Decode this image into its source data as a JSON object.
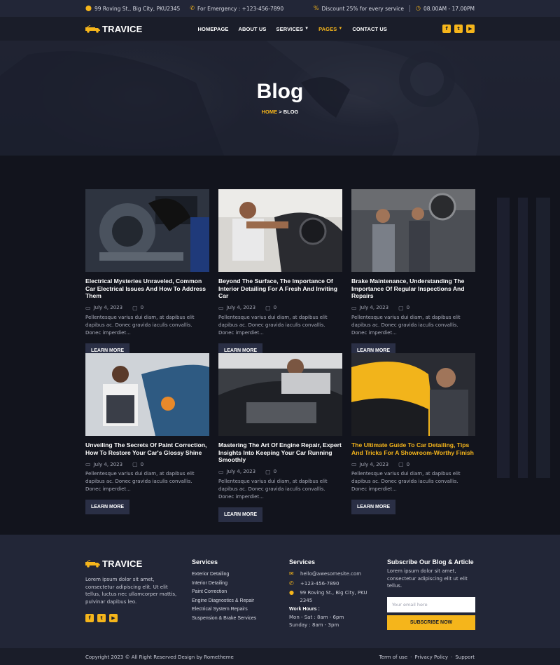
{
  "topbar": {
    "address": "99 Roving St., Big City, PKU2345",
    "emergency": "For Emergency : +123-456-7890",
    "discount": "Discount 25% for every service",
    "hours": "08.00AM - 17.00PM"
  },
  "nav": {
    "logo": "TRAVICE",
    "items": [
      "HOMEPAGE",
      "ABOUT US",
      "SERVICES",
      "PAGES",
      "CONTACT US"
    ],
    "socials": [
      "f",
      "t",
      "▶"
    ]
  },
  "hero": {
    "title": "Blog",
    "home": "HOME",
    "sep": ">",
    "current": "BLOG"
  },
  "posts": [
    {
      "title": "Electrical Mysteries Unraveled, Common Car Electrical Issues And How To Address Them",
      "date": "July 4, 2023",
      "comments": "0",
      "excerpt": "Pellentesque varius dui diam, at dapibus elit dapibus ac. Donec gravida iaculis convallis. Donec imperdiet...",
      "button": "LEARN MORE"
    },
    {
      "title": "Beyond The Surface, The Importance Of Interior Detailing For A Fresh And Inviting Car",
      "date": "July 4, 2023",
      "comments": "0",
      "excerpt": "Pellentesque varius dui diam, at dapibus elit dapibus ac. Donec gravida iaculis convallis. Donec imperdiet...",
      "button": "LEARN MORE"
    },
    {
      "title": "Brake Maintenance, Understanding The Importance Of Regular Inspections And Repairs",
      "date": "July 4, 2023",
      "comments": "0",
      "excerpt": "Pellentesque varius dui diam, at dapibus elit dapibus ac. Donec gravida iaculis convallis. Donec imperdiet...",
      "button": "LEARN MORE"
    },
    {
      "title": "Unveiling The Secrets Of Paint Correction, How To Restore Your Car's Glossy Shine",
      "date": "July 4, 2023",
      "comments": "0",
      "excerpt": "Pellentesque varius dui diam, at dapibus elit dapibus ac. Donec gravida iaculis convallis. Donec imperdiet...",
      "button": "LEARN MORE"
    },
    {
      "title": "Mastering The Art Of Engine Repair, Expert Insights Into Keeping Your Car Running Smoothly",
      "date": "July 4, 2023",
      "comments": "0",
      "excerpt": "Pellentesque varius dui diam, at dapibus elit dapibus ac. Donec gravida iaculis convallis. Donec imperdiet...",
      "button": "LEARN MORE"
    },
    {
      "title": "The Ultimate Guide To Car Detailing, Tips And Tricks For A Showroom-Worthy Finish",
      "date": "July 4, 2023",
      "comments": "0",
      "excerpt": "Pellentesque varius dui diam, at dapibus elit dapibus ac. Donec gravida iaculis convallis. Donec imperdiet...",
      "button": "LEARN MORE"
    }
  ],
  "footer": {
    "logo": "TRAVICE",
    "about": "Lorem ipsum dolor sit amet, consectetur adipiscing elit. Ut elit tellus, luctus nec ullamcorper mattis, pulvinar dapibus leo.",
    "services_title": "Services",
    "services": [
      "Exterior Detailing",
      "Interior Detailing",
      "Paint Correction",
      "Engine Diagnostics & Repair",
      "Electrical System Repairs",
      "Suspension & Brake Services"
    ],
    "contact_title": "Services",
    "email": "hello@awesomesite.com",
    "phone": "+123-456-7890",
    "address": "99 Roving St., Big City, PKU 2345",
    "hours_title": "Work Hours :",
    "hours1": "Mon - Sat : 8am - 6pm",
    "hours2": "Sunday : 8am - 3pm",
    "subscribe_title": "Subscribe Our Blog & Article",
    "subscribe_text": "Lorem ipsum dolor sit amet, consectetur adipiscing elit ut elit tellus.",
    "email_placeholder": "Your email here",
    "subscribe_button": "SUBSCRIBE NOW",
    "copyright": "Copyright 2023 © All Right Reserved Design by Rometheme",
    "links": [
      "Term of use",
      "Privacy Policy",
      "Support"
    ]
  },
  "colors": {
    "accent": "#f5b51b",
    "dark": "#12141d",
    "panel": "#222637"
  }
}
